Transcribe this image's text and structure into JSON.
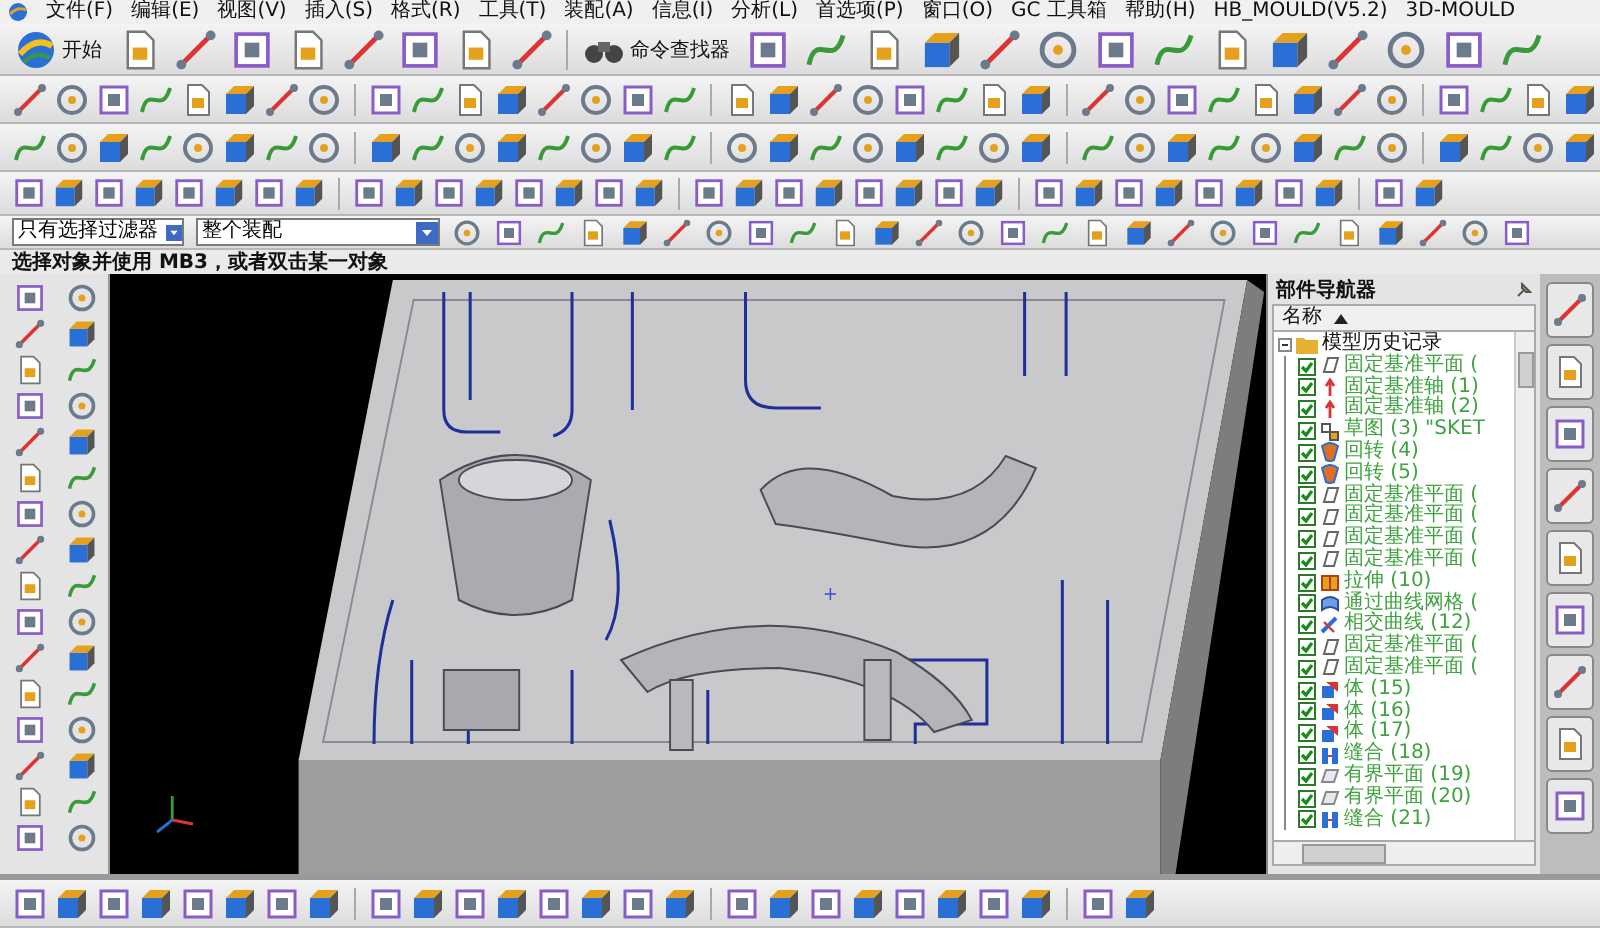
{
  "menu": [
    {
      "label": "文件(F)"
    },
    {
      "label": "编辑(E)"
    },
    {
      "label": "视图(V)"
    },
    {
      "label": "插入(S)"
    },
    {
      "label": "格式(R)"
    },
    {
      "label": "工具(T)"
    },
    {
      "label": "装配(A)"
    },
    {
      "label": "信息(I)"
    },
    {
      "label": "分析(L)"
    },
    {
      "label": "首选项(P)"
    },
    {
      "label": "窗口(O)"
    },
    {
      "label": "GC 工具箱"
    },
    {
      "label": "帮助(H)"
    },
    {
      "label": "HB_MOULD(V5.2)"
    },
    {
      "label": "3D-MOULD"
    }
  ],
  "toolbar": {
    "start_button": "开始",
    "command_finder": "命令查找器"
  },
  "selection_bar": {
    "filter": "只有选择过滤器",
    "scope": "整个装配"
  },
  "status_bar": "选择对象并使用 MB3，或者双击某一对象",
  "part_navigator": {
    "title": "部件导航器",
    "column": "名称",
    "root": {
      "label": "模型历史记录",
      "expanded": true,
      "children": [
        {
          "label": "固定基准平面 (",
          "kind": "datum-plane",
          "checked": true
        },
        {
          "label": "固定基准轴 (1)",
          "kind": "datum-axis",
          "checked": true
        },
        {
          "label": "固定基准轴 (2)",
          "kind": "datum-axis",
          "checked": true
        },
        {
          "label": "草图 (3) \"SKET",
          "kind": "sketch",
          "checked": true
        },
        {
          "label": "回转 (4)",
          "kind": "revolve",
          "checked": true
        },
        {
          "label": "回转 (5)",
          "kind": "revolve",
          "checked": true
        },
        {
          "label": "固定基准平面 (",
          "kind": "datum-plane",
          "checked": true
        },
        {
          "label": "固定基准平面 (",
          "kind": "datum-plane",
          "checked": true
        },
        {
          "label": "固定基准平面 (",
          "kind": "datum-plane",
          "checked": true
        },
        {
          "label": "固定基准平面 (",
          "kind": "datum-plane",
          "checked": true
        },
        {
          "label": "拉伸 (10)",
          "kind": "extrude",
          "checked": true
        },
        {
          "label": "通过曲线网格 (",
          "kind": "mesh",
          "checked": true
        },
        {
          "label": "相交曲线 (12)",
          "kind": "curve",
          "checked": true
        },
        {
          "label": "固定基准平面 (",
          "kind": "datum-plane",
          "checked": true
        },
        {
          "label": "固定基准平面 (",
          "kind": "datum-plane",
          "checked": true
        },
        {
          "label": "体 (15)",
          "kind": "body",
          "checked": true
        },
        {
          "label": "体 (16)",
          "kind": "body",
          "checked": true
        },
        {
          "label": "体 (17)",
          "kind": "body",
          "checked": true
        },
        {
          "label": "缝合 (18)",
          "kind": "sew",
          "checked": true
        },
        {
          "label": "有界平面 (19)",
          "kind": "bounded-plane",
          "checked": true
        },
        {
          "label": "有界平面 (20)",
          "kind": "bounded-plane",
          "checked": true
        },
        {
          "label": "缝合 (21)",
          "kind": "sew",
          "checked": true
        }
      ]
    }
  }
}
